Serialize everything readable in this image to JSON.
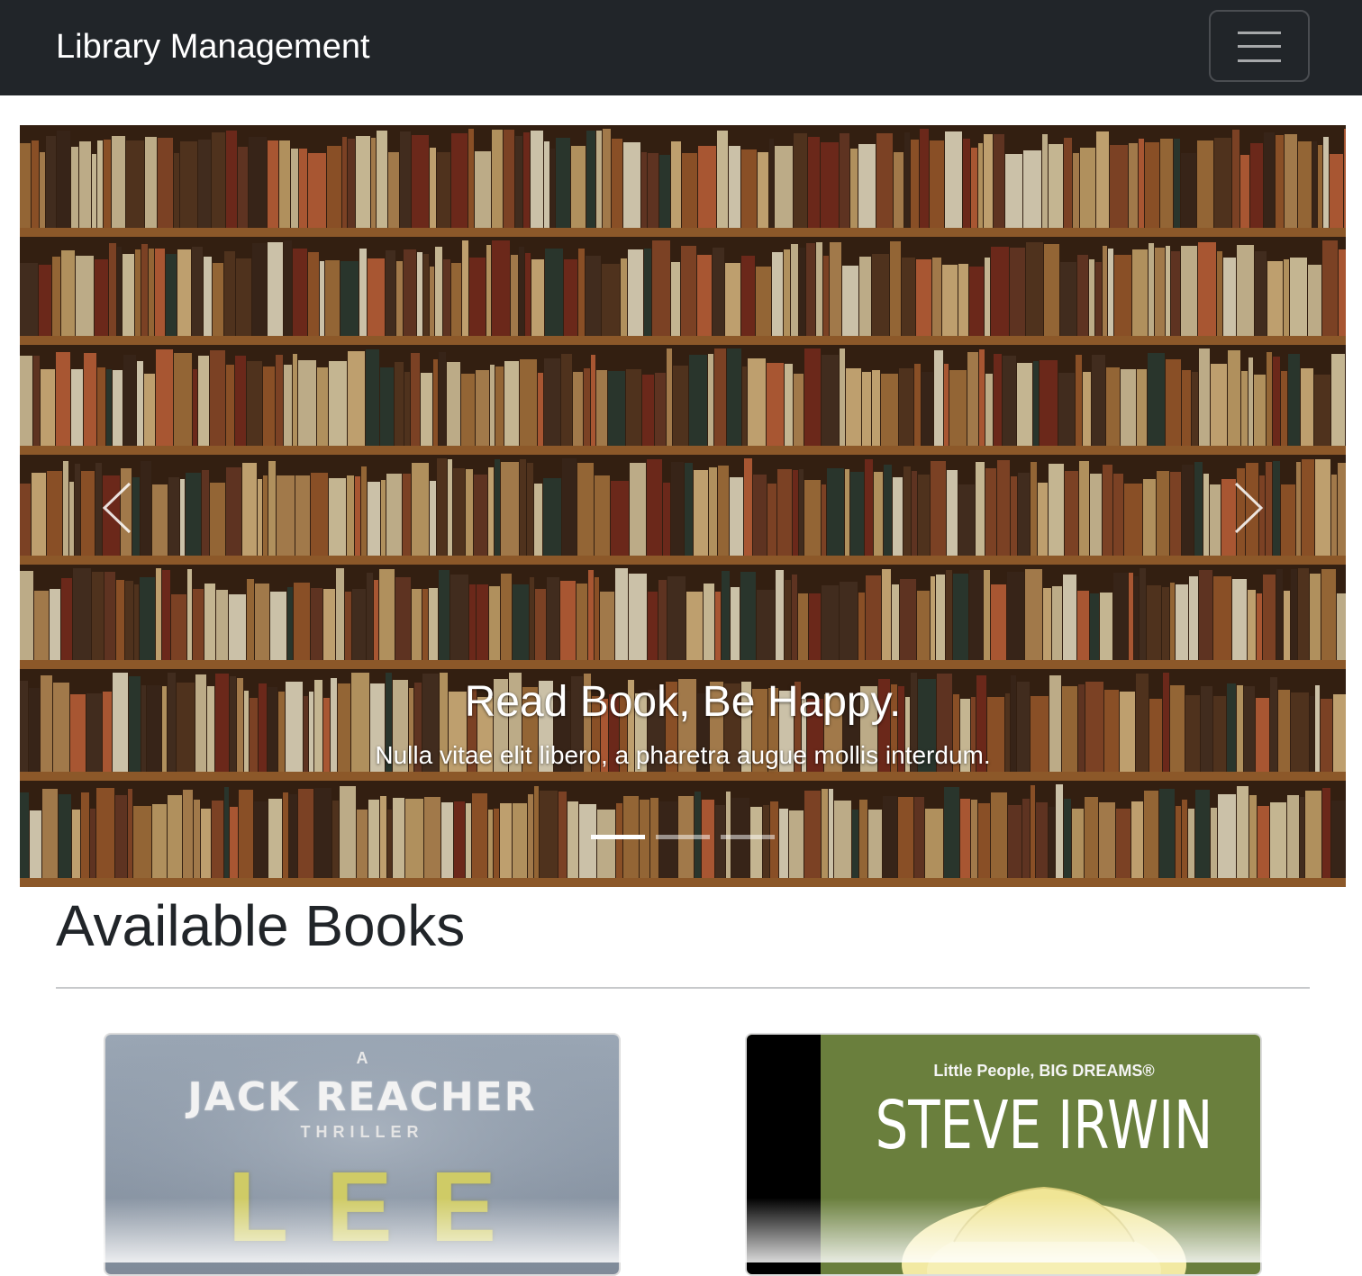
{
  "navbar": {
    "brand": "Library Management",
    "toggler_icon": "hamburger-menu-icon",
    "background": "#212529"
  },
  "carousel": {
    "slide": {
      "title": "Read Book, Be Happy.",
      "text": "Nulla vitae elit libero, a pharetra augue mollis interdum."
    },
    "prev_icon": "chevron-left-icon",
    "next_icon": "chevron-right-icon",
    "indicators": [
      {
        "active": true
      },
      {
        "active": false
      },
      {
        "active": false
      }
    ]
  },
  "main": {
    "section_title": "Available Books"
  },
  "books": [
    {
      "cover": {
        "series": "A",
        "headline": "JACK REACHER",
        "subheadline": "THRILLER",
        "author": "LEE"
      }
    },
    {
      "cover": {
        "series": "Little People, BIG DREAMS®",
        "headline": "STEVE IRWIN"
      }
    }
  ],
  "colors": {
    "navbar": "#212529",
    "shelf_wood": "#8a5a2b",
    "card_border": "#dcdcdc",
    "steve_irwin_green": "#6a7f3d",
    "jack_reacher_grey": "#8f9bab"
  }
}
